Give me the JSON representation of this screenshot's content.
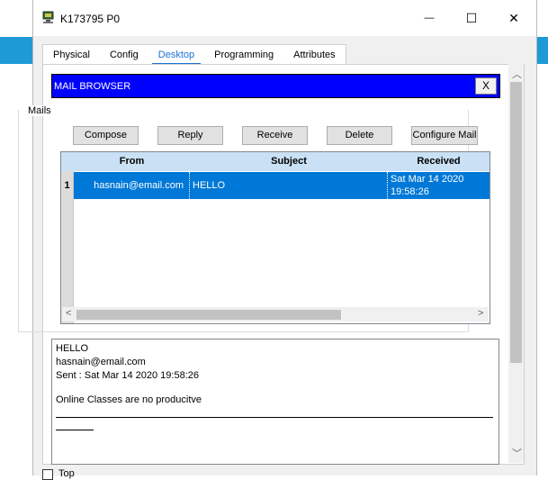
{
  "window": {
    "title": "K173795 P0",
    "minimize_glyph": "—",
    "maximize_glyph": "☐",
    "close_glyph": "✕"
  },
  "tabs": [
    {
      "label": "Physical",
      "active": false
    },
    {
      "label": "Config",
      "active": false
    },
    {
      "label": "Desktop",
      "active": true
    },
    {
      "label": "Programming",
      "active": false
    },
    {
      "label": "Attributes",
      "active": false
    }
  ],
  "mail_browser": {
    "title": "MAIL BROWSER",
    "close_label": "X",
    "group_label": "Mails",
    "buttons": {
      "compose": "Compose",
      "reply": "Reply",
      "receive": "Receive",
      "delete": "Delete",
      "configure": "Configure Mail"
    },
    "table": {
      "columns": [
        "From",
        "Subject",
        "Received"
      ],
      "rows": [
        {
          "num": "1",
          "from": "hasnain@email.com",
          "subject": "HELLO",
          "received_date": "Sat Mar 14 2020",
          "received_time": "19:58:26"
        }
      ]
    },
    "message": {
      "subject": "HELLO",
      "from": "hasnain@email.com",
      "sent": "Sent : Sat Mar 14 2020 19:58:26",
      "body": "Online Classes are no producitve"
    }
  },
  "footer": {
    "checkbox_label": "Top"
  },
  "colors": {
    "accent": "#0078d7",
    "header_blue": "#0000ff",
    "desktop_bar": "#1e9ad6"
  }
}
